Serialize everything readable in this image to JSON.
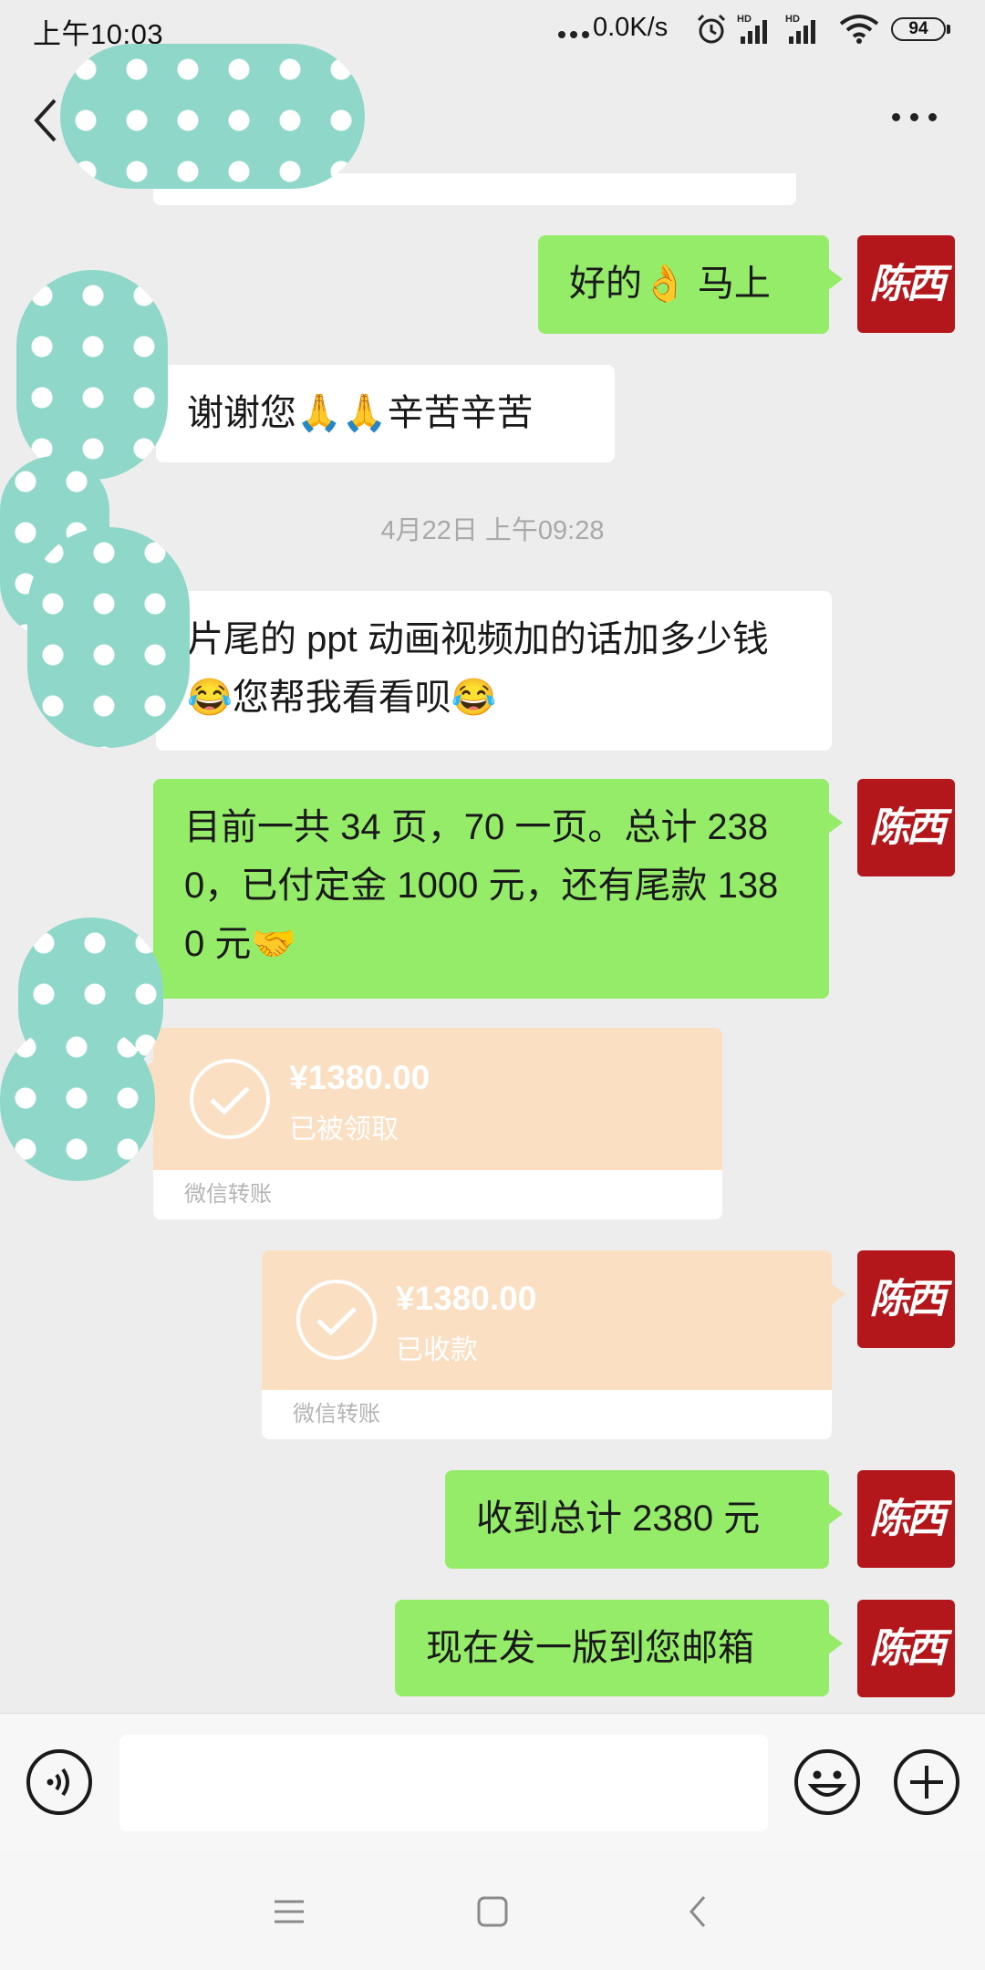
{
  "status_bar": {
    "time": "上午10:03",
    "net_speed": "0.0K/s",
    "battery": "94",
    "icons": [
      "notification-dots-icon",
      "alarm-icon",
      "hd-signal-icon",
      "hd-signal-icon",
      "wifi-icon",
      "battery-icon"
    ]
  },
  "header": {
    "icons": [
      "back-chevron-icon",
      "more-options-icon"
    ]
  },
  "avatar": {
    "text": "陈西"
  },
  "colors": {
    "background": "#ededed",
    "bubble_green": "#95ec69",
    "bubble_white": "#ffffff",
    "transfer": "#fbdfc3",
    "avatar": "#b3161b"
  },
  "chat": {
    "messages": [
      {
        "text": "好的👌 马上"
      },
      {
        "text": "谢谢您🙏🙏辛苦辛苦"
      },
      {
        "text": "片尾的 ppt 动画视频加的话加多少钱😂您帮我看看呗😂"
      },
      {
        "text": "目前一共 34 页，70 一页。总计 2380，已付定金 1000 元，还有尾款 1380 元🤝"
      },
      {
        "text": "收到总计 2380 元"
      },
      {
        "text": "现在发一版到您邮箱"
      }
    ],
    "timestamp": "4月22日 上午09:28",
    "transfers": [
      {
        "amount": "¥1380.00",
        "status": "已被领取",
        "footer": "微信转账"
      },
      {
        "amount": "¥1380.00",
        "status": "已收款",
        "footer": "微信转账"
      }
    ]
  },
  "input_bar": {
    "icons": [
      "voice-icon",
      "emoji-icon",
      "plus-icon"
    ]
  },
  "nav_bar": {
    "icons": [
      "menu-icon",
      "home-icon",
      "back-icon"
    ]
  }
}
